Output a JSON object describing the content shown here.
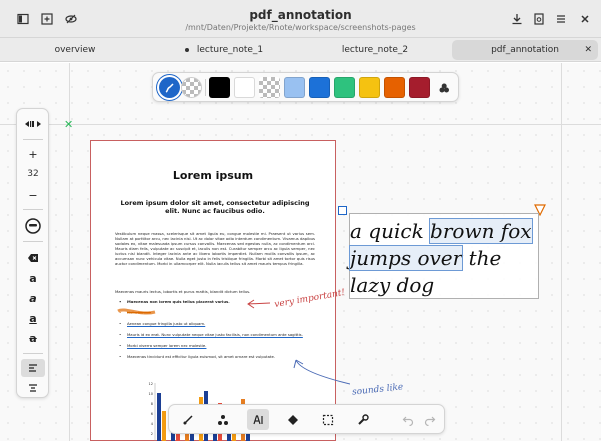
{
  "window": {
    "title": "pdf_annotation",
    "path": "/mnt/Daten/Projekte/Rnote/workspace/screenshots-pages"
  },
  "header_icons": {
    "left": [
      "sidebar-icon",
      "add-document-icon",
      "no-eye-icon"
    ],
    "right": [
      "download-icon",
      "document-icon",
      "menu-icon",
      "close-icon"
    ]
  },
  "tabs": [
    {
      "label": "overview",
      "modified": false,
      "active": false
    },
    {
      "label": "lecture_note_1",
      "modified": true,
      "active": false
    },
    {
      "label": "lecture_note_2",
      "modified": false,
      "active": false
    },
    {
      "label": "pdf_annotation",
      "modified": false,
      "active": true
    }
  ],
  "pen_toolbar": {
    "colors": [
      "#000000",
      "#ffffff",
      "#99c1f1",
      "#1c71d8",
      "#2ec27e",
      "#f5c211",
      "#e66100",
      "#a51d2d"
    ]
  },
  "sidebar": {
    "zoom_in": "+",
    "zoom_value": "32",
    "zoom_out": "−"
  },
  "pdf": {
    "title": "Lorem ipsum",
    "subtitle": "Lorem ipsum dolor sit amet, consectetur adipiscing elit. Nunc ac faucibus odio.",
    "paragraph1": "Vestibulum neque massa, scelerisque sit amet ligula eu, congue molestie mi. Praesent ut varius sem. Nullam at porttitor arcu, nec lacinia nisi. Ut ac dolor vitae odio interdum condimentum. Vivamus dapibus sodales ex, vitae malesuada ipsum cursus convallis. Maecenas sed egestas nulla, ac condimentum orci. Mauris diam felis, vulputate ac suscipit et, iaculis non est. Curabitur semper arcu ac ligula semper, nec luctus nisl blandit. Integer lacinia ante ac libero lobortis imperdiet. Nullam mollis convallis ipsum, ac accumsan nunc vehicula vitae. Nulla eget justo in felis tristique fringilla. Morbi sit amet tortor quis risus auctor condimentum. Morbi in ullamcorper elit. Nulla iaculis tellus sit amet mauris tempus fringilla.",
    "paragraph2": "Maecenas mauris lectus, lobortis et purus mattis, blandit dictum tellus.",
    "list": [
      "Maecenas non lorem quis tellus placerat varius.",
      "Nulla facilisi.",
      "Aenean congue fringilla justo ut aliquam.",
      "Mauris id ex erat. Nunc vulputate neque vitae justo facilisis, non condimentum ante sagittis.",
      "Morbi viverra semper lorem nec molestie.",
      "Maecenas tincidunt est efficitur ligula euismod, sit amet ornare est vulputate."
    ],
    "chart_axis": [
      "12",
      "10",
      "8",
      "6",
      "4",
      "2"
    ]
  },
  "annotations": {
    "very_important": "very important!",
    "sounds_like": "sounds like"
  },
  "text_annotation": {
    "part1": "a quick ",
    "highlight1": "brown fox",
    "highlight2": "jumps over",
    "part2": " the lazy dog"
  },
  "colors": {
    "accent": "#1e66c8",
    "annotation_red": "#c94343",
    "page_border": "#c86060"
  }
}
